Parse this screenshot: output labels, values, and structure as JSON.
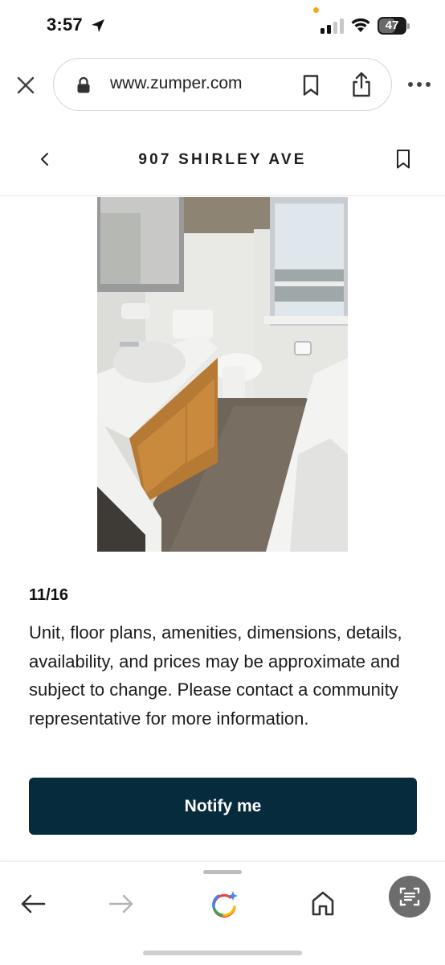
{
  "status_bar": {
    "time": "3:57",
    "battery": "47"
  },
  "browser": {
    "url": "www.zumper.com"
  },
  "header": {
    "title": "907 SHIRLEY AVE"
  },
  "gallery": {
    "counter": "11/16"
  },
  "content": {
    "disclaimer": "Unit, floor plans, amenities, dimensions, details, availability, and prices may be approximate and subject to change. Please contact a community representative for more information.",
    "notify_label": "Notify me"
  },
  "colors": {
    "button_bg": "#062b3d",
    "button_text": "#ffffff",
    "status_dot": "#f5a623"
  },
  "icons": {
    "status_bar": [
      "location-arrow-icon",
      "signal-bars-icon",
      "wifi-icon",
      "battery-icon"
    ],
    "browser": [
      "close-icon",
      "lock-icon",
      "bookmark-icon",
      "share-icon",
      "more-dots-icon"
    ],
    "header": [
      "chevron-left-icon",
      "bookmark-outline-icon"
    ],
    "toolbar": [
      "arrow-left-icon",
      "arrow-right-icon",
      "google-assistant-icon",
      "home-icon",
      "lens-icon"
    ]
  }
}
